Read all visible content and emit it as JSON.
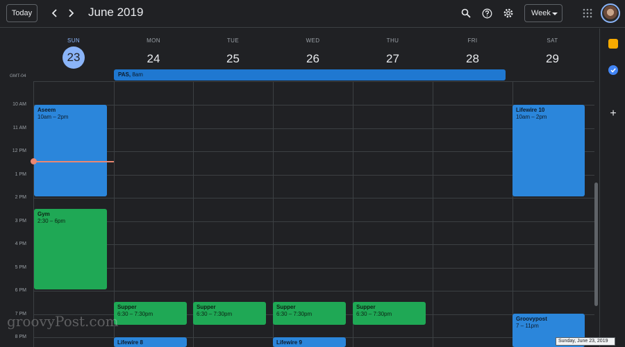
{
  "header": {
    "today_label": "Today",
    "prev_icon": "chevron-left-icon",
    "next_icon": "chevron-right-icon",
    "title": "June 2019",
    "view_label": "Week"
  },
  "days": [
    {
      "name": "SUN",
      "num": "23"
    },
    {
      "name": "MON",
      "num": "24"
    },
    {
      "name": "TUE",
      "num": "25"
    },
    {
      "name": "WED",
      "num": "26"
    },
    {
      "name": "THU",
      "num": "27"
    },
    {
      "name": "FRI",
      "num": "28"
    },
    {
      "name": "SAT",
      "num": "29"
    }
  ],
  "timezone": "GMT-04",
  "allday": {
    "title": "PAS,",
    "time": "8am"
  },
  "hours": [
    "10 AM",
    "11 AM",
    "12 PM",
    "1 PM",
    "2 PM",
    "3 PM",
    "4 PM",
    "5 PM",
    "6 PM",
    "7 PM",
    "8 PM"
  ],
  "events": [
    {
      "title": "Aseem",
      "time": "10am – 2pm",
      "color": "#2b86db"
    },
    {
      "title": "Gym",
      "time": "2:30 – 6pm",
      "color": "#1fa855"
    },
    {
      "title": "Supper",
      "time": "6:30 – 7:30pm",
      "color": "#1fa855"
    },
    {
      "title": "Supper",
      "time": "6:30 – 7:30pm",
      "color": "#1fa855"
    },
    {
      "title": "Supper",
      "time": "6:30 – 7:30pm",
      "color": "#1fa855"
    },
    {
      "title": "Supper",
      "time": "6:30 – 7:30pm",
      "color": "#1fa855"
    },
    {
      "title": "Lifewire 8",
      "time": "",
      "color": "#2b86db"
    },
    {
      "title": "Lifewire 9",
      "time": "",
      "color": "#2b86db"
    },
    {
      "title": "Lifewire 10",
      "time": "10am – 2pm",
      "color": "#2b86db"
    },
    {
      "title": "Groovypost",
      "time": "7 – 11pm",
      "color": "#2b86db"
    }
  ],
  "watermark": "groovyPost.com",
  "tooltip": "Sunday, June 23, 2019",
  "colors": {
    "accent": "#8ab4f8",
    "now_line": "#ea8872",
    "background": "#202124"
  }
}
